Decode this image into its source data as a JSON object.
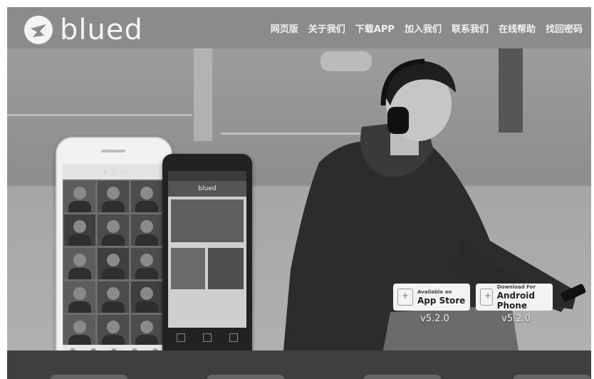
{
  "brand": {
    "name": "blued"
  },
  "nav": [
    {
      "label": "网页版"
    },
    {
      "label": "关于我们"
    },
    {
      "label": "下载APP"
    },
    {
      "label": "加入我们"
    },
    {
      "label": "联系我们"
    },
    {
      "label": "在线帮助"
    },
    {
      "label": "找回密码"
    }
  ],
  "downloads": {
    "appstore": {
      "small": "Available on",
      "big": "App Store",
      "version": "v5.2.0"
    },
    "android": {
      "small": "Download For",
      "big": "Android Phone",
      "version": "v5.2.0"
    }
  },
  "colors": {
    "header": "#8b8b8b",
    "footer": "#3f3f3f",
    "text": "#f2f2f2"
  }
}
